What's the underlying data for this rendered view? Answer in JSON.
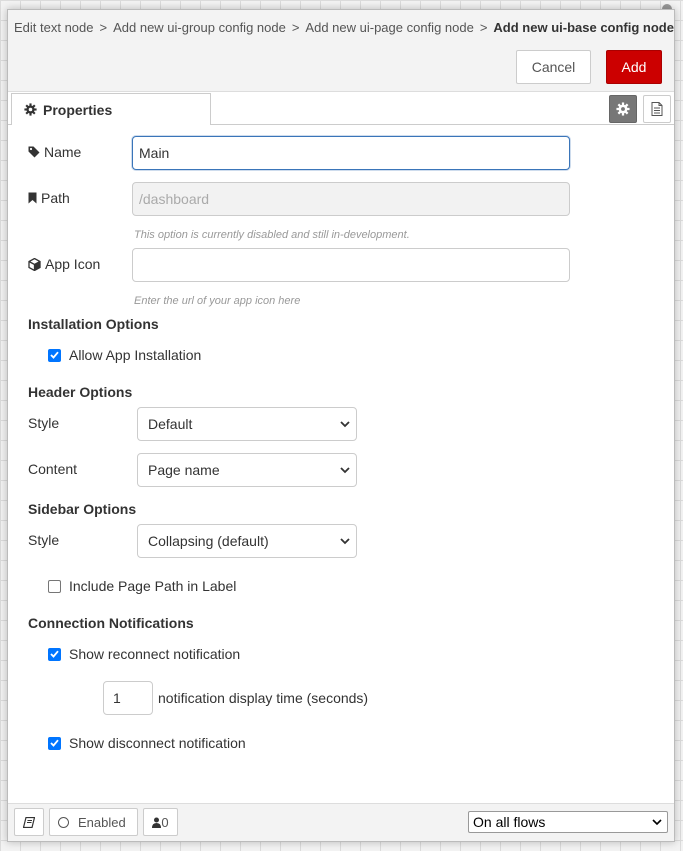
{
  "breadcrumb": {
    "items": [
      "Edit text node",
      "Add new ui-group config node",
      "Add new ui-page config node"
    ],
    "current": "Add new ui-base config node",
    "separator": ">"
  },
  "buttons": {
    "cancel": "Cancel",
    "add": "Add"
  },
  "tab": {
    "label": "Properties",
    "icon": "gear-icon"
  },
  "form": {
    "name": {
      "label": "Name",
      "value": "Main",
      "icon": "tag-icon"
    },
    "path": {
      "label": "Path",
      "placeholder": "/dashboard",
      "hint": "This option is currently disabled and still in-development.",
      "icon": "bookmark-icon"
    },
    "app_icon": {
      "label": "App Icon",
      "value": "",
      "hint": "Enter the url of your app icon here",
      "icon": "cube-icon"
    },
    "installation": {
      "title": "Installation Options",
      "allow_install": {
        "label": "Allow App Installation",
        "checked": true
      }
    },
    "header": {
      "title": "Header Options",
      "style_label": "Style",
      "style_value": "Default",
      "content_label": "Content",
      "content_value": "Page name"
    },
    "sidebar": {
      "title": "Sidebar Options",
      "style_label": "Style",
      "style_value": "Collapsing (default)",
      "include_path": {
        "label": "Include Page Path in Label",
        "checked": false
      }
    },
    "connection": {
      "title": "Connection Notifications",
      "reconnect": {
        "label": "Show reconnect notification",
        "checked": true
      },
      "display_time_value": "1",
      "display_time_label": "notification display time (seconds)",
      "disconnect": {
        "label": "Show disconnect notification",
        "checked": true
      }
    }
  },
  "footer": {
    "enabled_label": "Enabled",
    "users_count": "0",
    "flows_select": "On all flows"
  },
  "colors": {
    "accent": "#c00000",
    "focus": "#3a75b9",
    "checkbox": "#0075ff"
  }
}
